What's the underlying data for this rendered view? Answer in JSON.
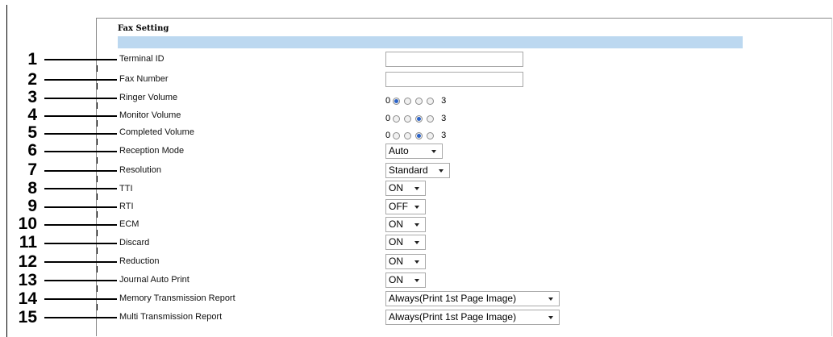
{
  "section_title": "Fax Setting",
  "callouts": [
    "1",
    "2",
    "3",
    "4",
    "5",
    "6",
    "7",
    "8",
    "9",
    "10",
    "11",
    "12",
    "13",
    "14",
    "15"
  ],
  "fields": {
    "terminal_id": {
      "label": "Terminal ID",
      "value": ""
    },
    "fax_number": {
      "label": "Fax Number",
      "value": ""
    },
    "ringer_volume": {
      "label": "Ringer Volume",
      "min": "0",
      "max": "3",
      "selected": 0
    },
    "monitor_volume": {
      "label": "Monitor Volume",
      "min": "0",
      "max": "3",
      "selected": 2
    },
    "completed_volume": {
      "label": "Completed Volume",
      "min": "0",
      "max": "3",
      "selected": 2
    },
    "reception_mode": {
      "label": "Reception Mode",
      "value": "Auto"
    },
    "resolution": {
      "label": "Resolution",
      "value": "Standard"
    },
    "tti": {
      "label": "TTI",
      "value": "ON"
    },
    "rti": {
      "label": "RTI",
      "value": "OFF"
    },
    "ecm": {
      "label": "ECM",
      "value": "ON"
    },
    "discard": {
      "label": "Discard",
      "value": "ON"
    },
    "reduction": {
      "label": "Reduction",
      "value": "ON"
    },
    "journal_auto_print": {
      "label": "Journal Auto Print",
      "value": "ON"
    },
    "memory_transmission_report": {
      "label": "Memory Transmission Report",
      "value": "Always(Print 1st Page Image)"
    },
    "multi_transmission_report": {
      "label": "Multi Transmission Report",
      "value": "Always(Print 1st Page Image)"
    }
  },
  "colors": {
    "header_bar": "#bcd8f0",
    "radio_selected": "#2b63c8"
  },
  "icons": {
    "dropdown": "chevron-down-icon",
    "radio": "radio-button"
  }
}
